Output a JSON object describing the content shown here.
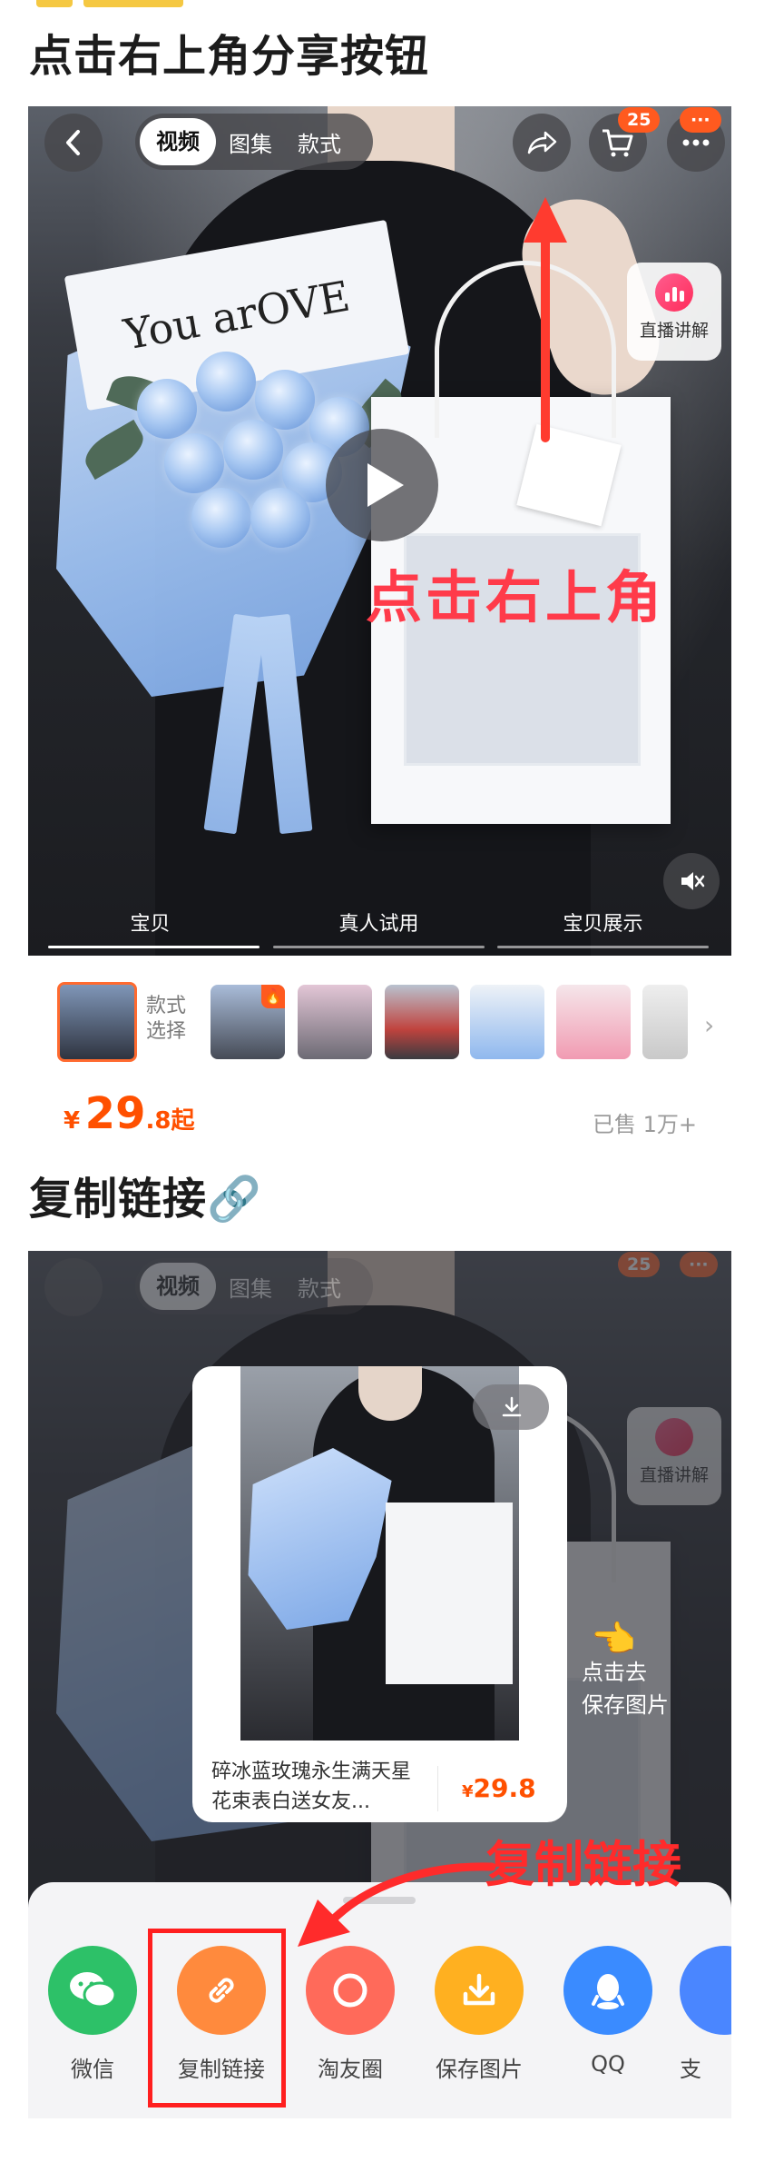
{
  "page": {
    "section1_title": "点击右上角分享按钮",
    "section2_title": "复制链接🔗"
  },
  "product": {
    "tabs": [
      "视频",
      "图集",
      "款式"
    ],
    "cart_badge": "25",
    "more_badge": "···",
    "live_label": "直播讲解",
    "annotation": "点击右上角",
    "bottom_tabs": [
      "宝贝",
      "真人试用",
      "宝贝展示"
    ],
    "style_select": [
      "款式",
      "选择"
    ],
    "price": {
      "currency": "¥",
      "integer": "29",
      "decimal": ".8",
      "suffix": "起"
    },
    "sold": "已售 1万+",
    "bouquet_card_text": "You arOVE"
  },
  "share_card": {
    "title": "碎冰蓝玫瑰永生满天星花束表白送女友...",
    "price_currency": "¥",
    "price": "29.8",
    "hint_line1": "点击去",
    "hint_line2": "保存图片",
    "hand_icon": "pointing-hand-icon"
  },
  "share_sheet": {
    "annotation": "复制链接",
    "items": [
      {
        "label": "微信",
        "icon": "wechat-icon",
        "color": "#2dc168"
      },
      {
        "label": "复制链接",
        "icon": "link-icon",
        "color": "#ff8a3d"
      },
      {
        "label": "淘友圈",
        "icon": "taoyouquan-icon",
        "color": "#ff6a5a"
      },
      {
        "label": "保存图片",
        "icon": "download-icon",
        "color": "#ffb020"
      },
      {
        "label": "QQ",
        "icon": "qq-icon",
        "color": "#3a8bff"
      },
      {
        "label": "支",
        "icon": "alipay-icon",
        "color": "#4a86ff"
      }
    ]
  },
  "colors": {
    "accent": "#ff5000",
    "annotation_red": "#ff3b4a"
  }
}
